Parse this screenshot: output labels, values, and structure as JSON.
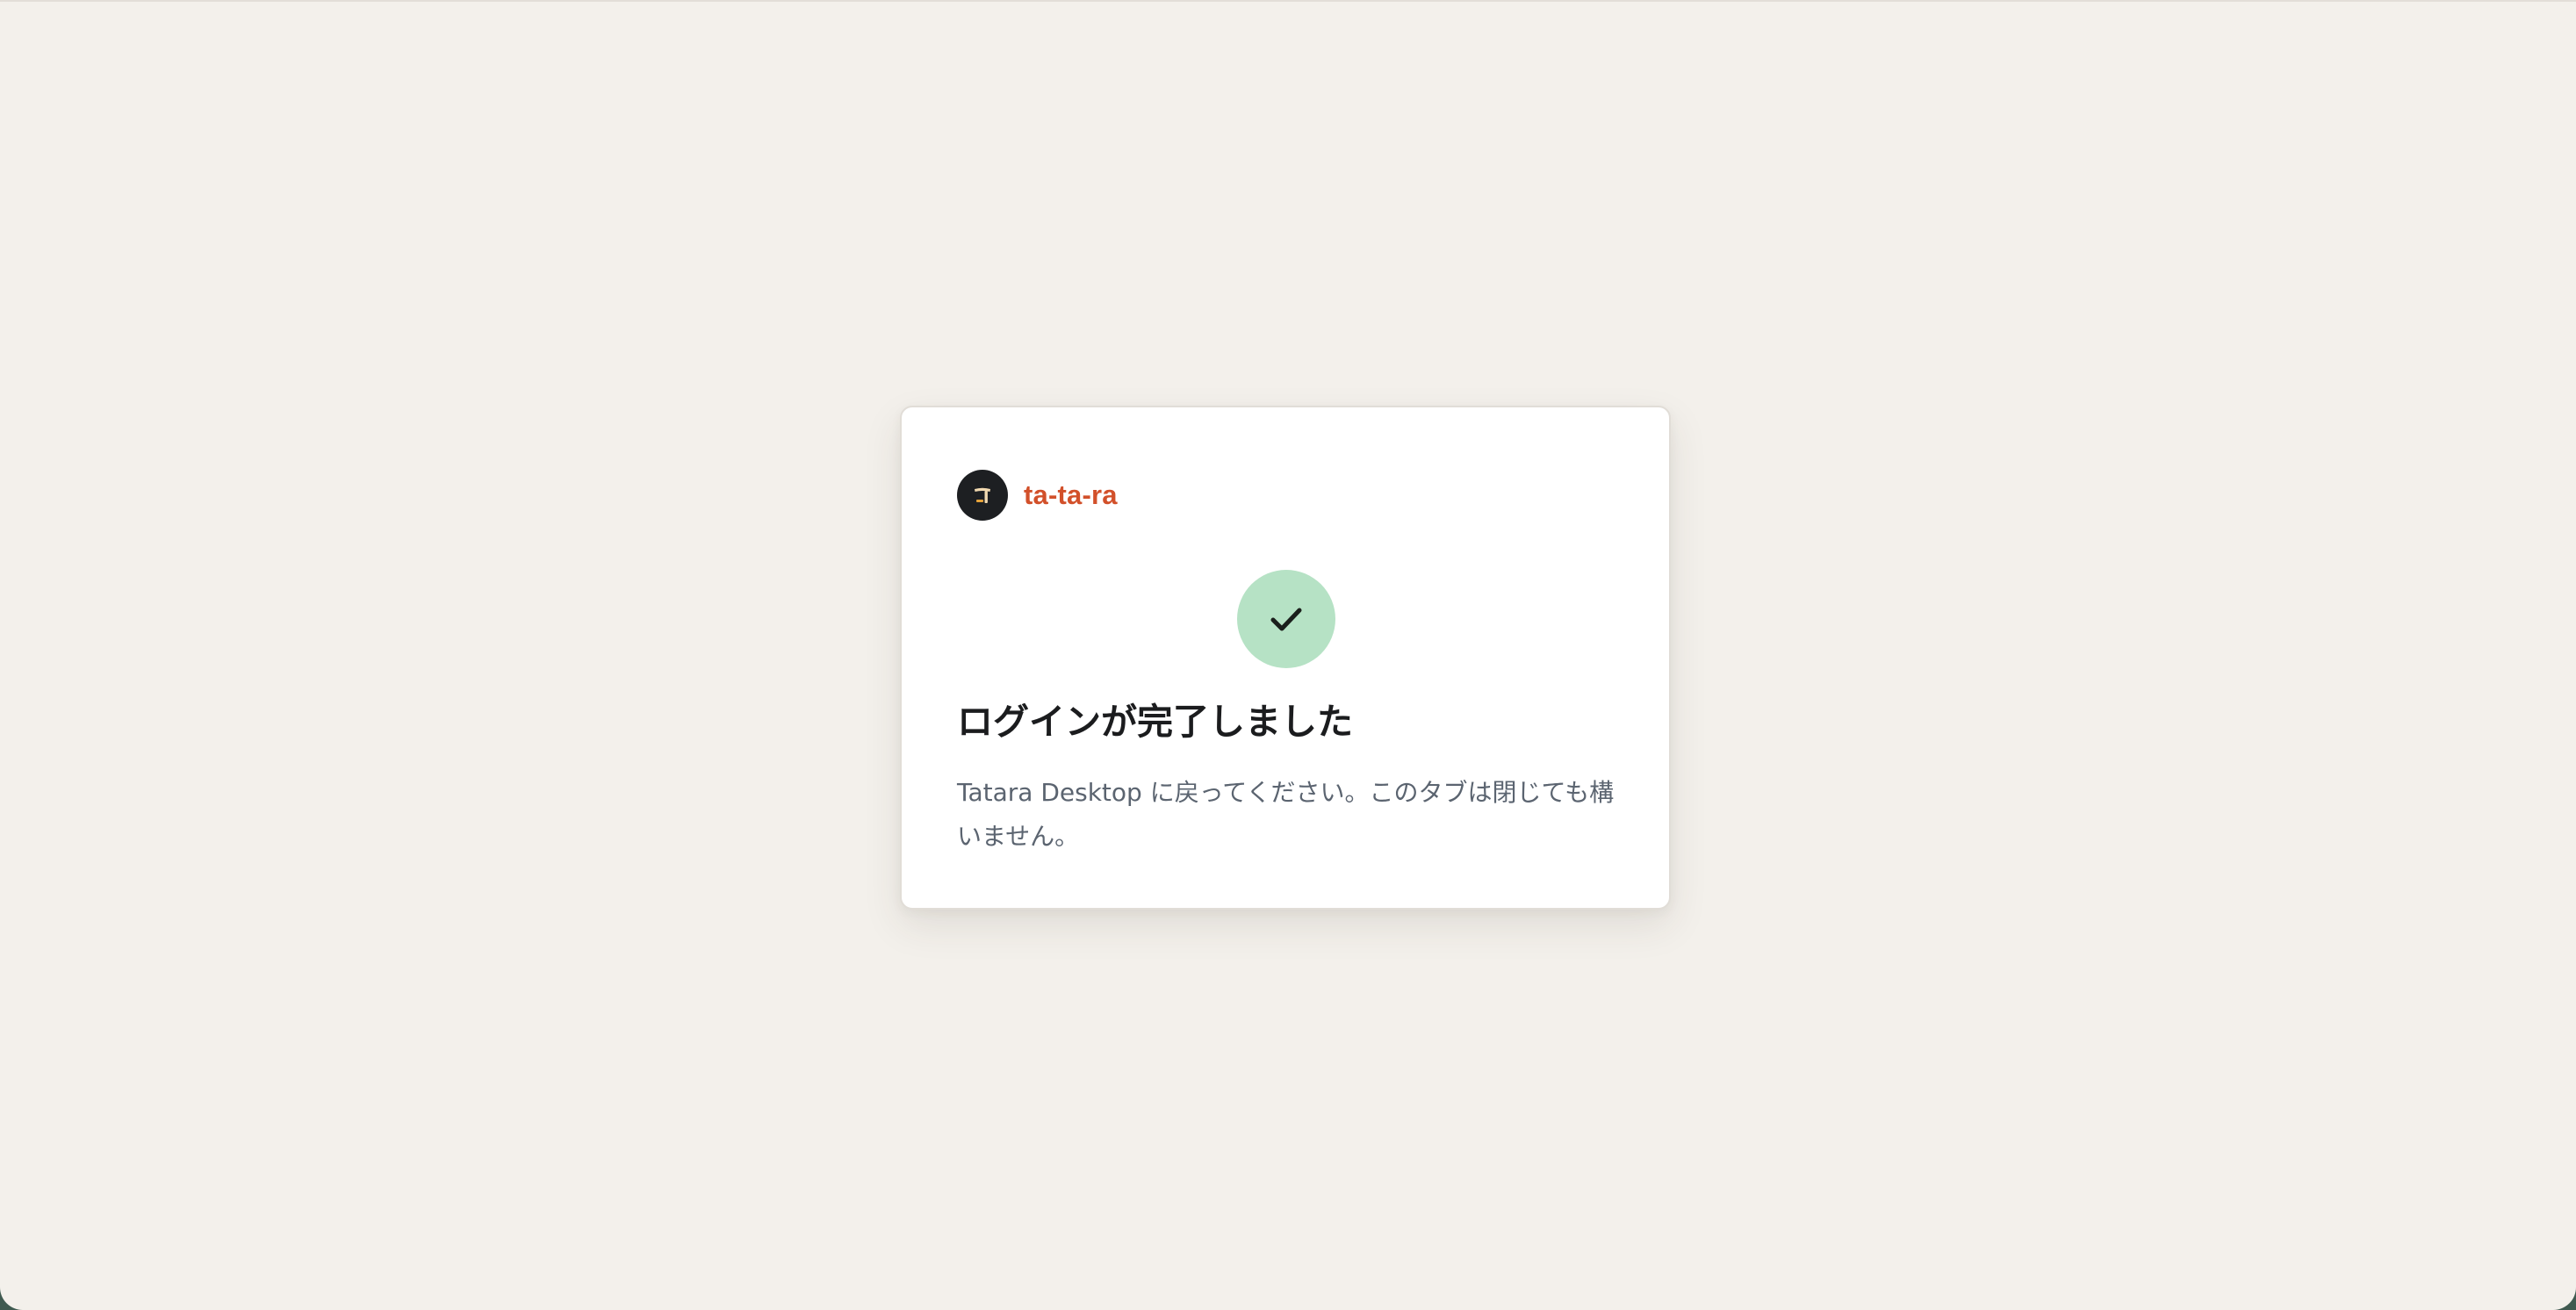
{
  "brand": {
    "logo_icon": "torii-logo-icon",
    "name": "ta-ta-ra",
    "accent_color": "#d2502a"
  },
  "status": {
    "icon": "check-icon",
    "color": "#b6e2c5",
    "title": "ログインが完了しました",
    "message": "Tatara Desktop に戻ってください。このタブは閉じても構いません。"
  }
}
